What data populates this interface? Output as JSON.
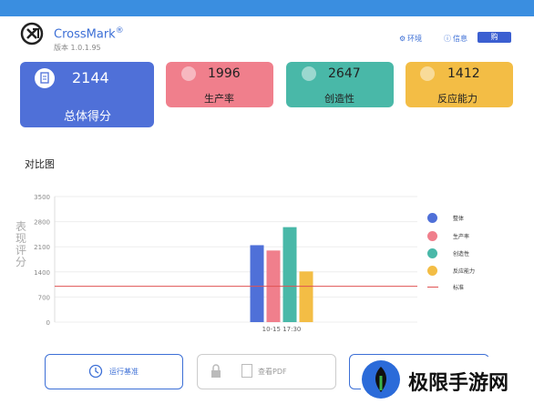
{
  "app": {
    "name": "CrossMark",
    "reg": "®",
    "version": "版本 1.0.1.95"
  },
  "header": {
    "env_label": "环境",
    "info_label": "信息",
    "buy_label": "购"
  },
  "cards": {
    "overall": {
      "value": "2144",
      "label": "总体得分"
    },
    "productivity": {
      "value": "1996",
      "label": "生产率",
      "color": "#f07f8c"
    },
    "creativity": {
      "value": "2647",
      "label": "创造性",
      "color": "#49b8a8"
    },
    "responsiveness": {
      "value": "1412",
      "label": "反应能力",
      "color": "#f3bd45"
    }
  },
  "section": {
    "title": "对比图"
  },
  "chart_data": {
    "type": "bar",
    "categories": [
      "10-15 17:30"
    ],
    "ylabel": "表现评分",
    "yticks": [
      "3500",
      "2800",
      "2100",
      "1400",
      "700",
      "0"
    ],
    "ylim": [
      0,
      3500
    ],
    "series": [
      {
        "name": "整体",
        "values": [
          2144
        ],
        "color": "#4f70d8"
      },
      {
        "name": "生产率",
        "values": [
          1996
        ],
        "color": "#f07f8c"
      },
      {
        "name": "创造性",
        "values": [
          2647
        ],
        "color": "#49b8a8"
      },
      {
        "name": "反应能力",
        "values": [
          1412
        ],
        "color": "#f3bd45"
      }
    ],
    "baseline": {
      "name": "标准",
      "value": 1000,
      "color": "#e05252"
    },
    "legend": "right",
    "grid": true
  },
  "buttons": {
    "run": "运行基准",
    "pdf": "查看PDF"
  },
  "watermark": {
    "text": "极限手游网"
  }
}
